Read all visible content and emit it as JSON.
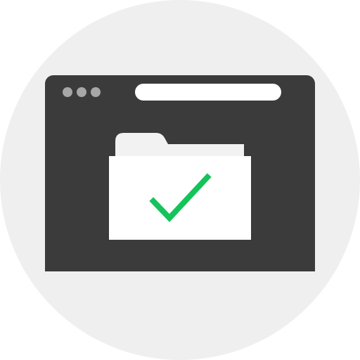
{
  "illustration": {
    "subject": "browser-window-folder-check",
    "icons": [
      "window-dots",
      "address-bar",
      "folder-icon",
      "check-icon"
    ]
  },
  "colors": {
    "background_circle": "#efefef",
    "window_frame": "#3b3b3b",
    "window_dots": "#a7a7a7",
    "address_bar": "#ffffff",
    "folder_tab": "#f2f2f2",
    "folder_body": "#ffffff",
    "check_mark": "#14c35a"
  }
}
